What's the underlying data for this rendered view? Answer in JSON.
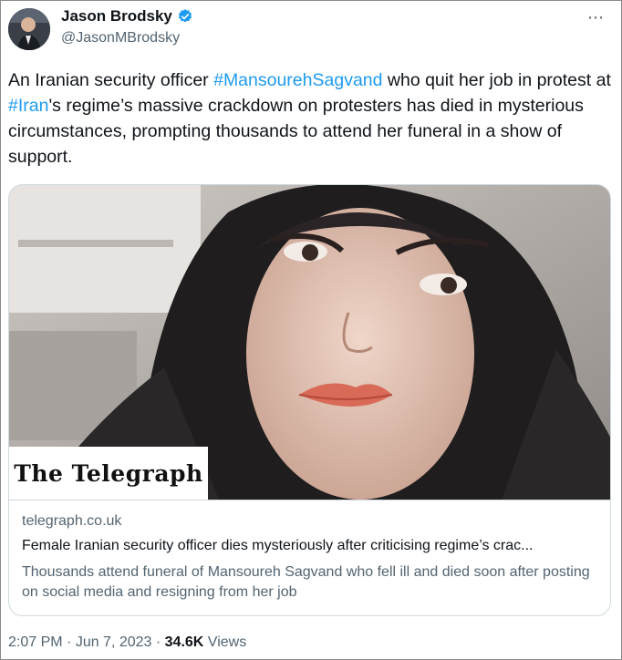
{
  "author": {
    "display_name": "Jason Brodsky",
    "handle": "@JasonMBrodsky",
    "verified": true
  },
  "more_icon": "⋯",
  "tweet": {
    "text_parts": {
      "p1": "An Iranian security officer ",
      "tag1": "#MansourehSagvand",
      "p2": " who quit her job in protest at ",
      "tag2": "#Iran",
      "p3": "'s regime’s massive crackdown on protesters has died in mysterious circumstances, prompting thousands to attend her funeral in a show of support."
    }
  },
  "card": {
    "logo_text": "The Telegraph",
    "domain": "telegraph.co.uk",
    "title": "Female Iranian security officer dies mysteriously after criticising regime’s crac...",
    "description": "Thousands attend funeral of Mansoureh Sagvand who fell ill and died soon after posting on social media and resigning from her job"
  },
  "footer": {
    "time": "2:07 PM",
    "separator1": " · ",
    "date": "Jun 7, 2023",
    "separator2": " · ",
    "views_count": "34.6K",
    "views_label": " Views"
  },
  "colors": {
    "link": "#1d9bf0",
    "secondary_text": "#536471",
    "verified_badge": "#1d9bf0"
  }
}
